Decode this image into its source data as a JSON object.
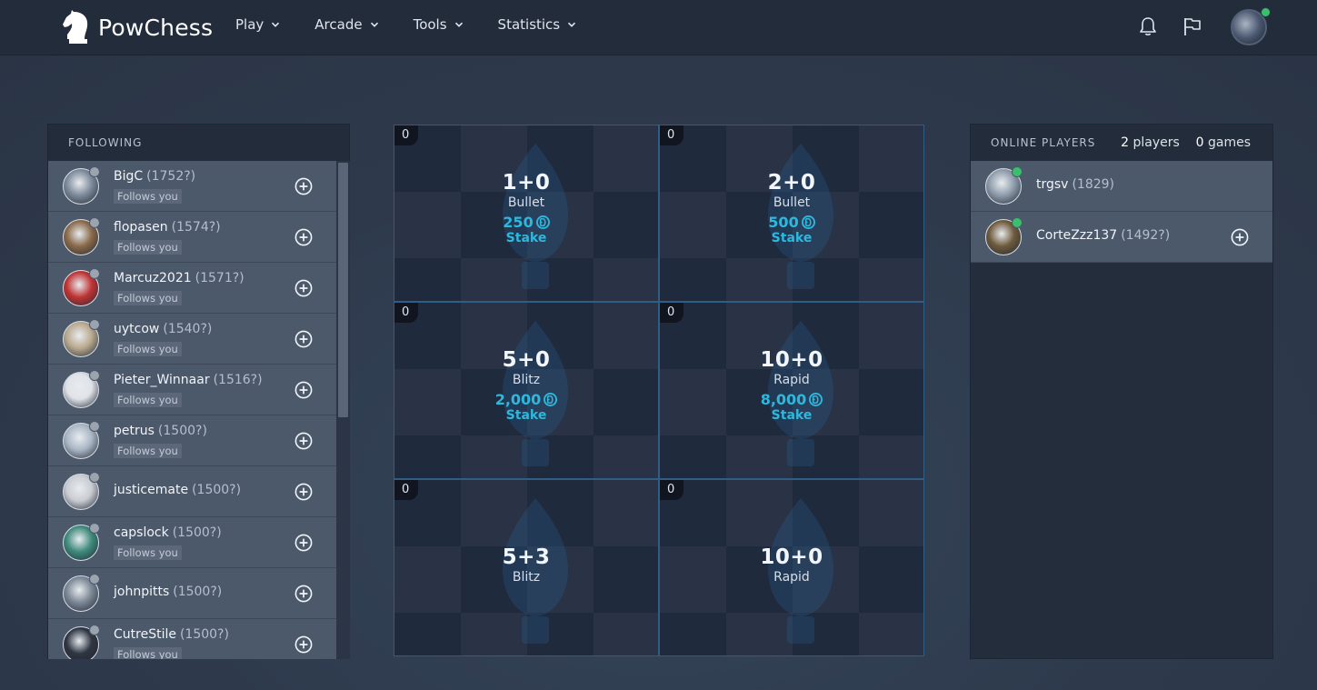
{
  "app": {
    "name": "PowChess"
  },
  "nav": [
    {
      "label": "Play"
    },
    {
      "label": "Arcade"
    },
    {
      "label": "Tools"
    },
    {
      "label": "Statistics"
    }
  ],
  "following": {
    "title": "FOLLOWING",
    "rows": [
      {
        "name": "BigC",
        "rating": "(1752?)",
        "sub": "Follows you",
        "avatar": "#7d8a9a"
      },
      {
        "name": "flopasen",
        "rating": "(1574?)",
        "sub": "Follows you",
        "avatar": "#8a6a4a"
      },
      {
        "name": "Marcuz2021",
        "rating": "(1571?)",
        "sub": "Follows you",
        "avatar": "#c03434"
      },
      {
        "name": "uytcow",
        "rating": "(1540?)",
        "sub": "Follows you",
        "avatar": "#b9a98f"
      },
      {
        "name": "Pieter_Winnaar",
        "rating": "(1516?)",
        "sub": "Follows you",
        "avatar": "#dfe3e8"
      },
      {
        "name": "petrus",
        "rating": "(1500?)",
        "sub": "Follows you",
        "avatar": "#a9b6c4"
      },
      {
        "name": "justicemate",
        "rating": "(1500?)",
        "sub": "",
        "avatar": "#c9ccd2"
      },
      {
        "name": "capslock",
        "rating": "(1500?)",
        "sub": "Follows you",
        "avatar": "#3f8a7b"
      },
      {
        "name": "johnpitts",
        "rating": "(1500?)",
        "sub": "",
        "avatar": "#7c8795"
      },
      {
        "name": "CutreStile",
        "rating": "(1500?)",
        "sub": "Follows you",
        "avatar": "#2f3642"
      }
    ]
  },
  "games": [
    {
      "count": "0",
      "time": "1+0",
      "mode": "Bullet",
      "stake": "250",
      "stake_label": "Stake"
    },
    {
      "count": "0",
      "time": "2+0",
      "mode": "Bullet",
      "stake": "500",
      "stake_label": "Stake"
    },
    {
      "count": "0",
      "time": "5+0",
      "mode": "Blitz",
      "stake": "2,000",
      "stake_label": "Stake"
    },
    {
      "count": "0",
      "time": "10+0",
      "mode": "Rapid",
      "stake": "8,000",
      "stake_label": "Stake"
    },
    {
      "count": "0",
      "time": "5+3",
      "mode": "Blitz",
      "stake": "",
      "stake_label": ""
    },
    {
      "count": "0",
      "time": "10+0",
      "mode": "Rapid",
      "stake": "",
      "stake_label": ""
    }
  ],
  "online": {
    "title": "ONLINE PLAYERS",
    "players_count": "2",
    "players_label": "players",
    "games_count": "0",
    "games_label": "games",
    "rows": [
      {
        "name": "trgsv",
        "rating": "(1829)",
        "avatar": "#8e9cab"
      },
      {
        "name": "CorteZzz137",
        "rating": "(1492?)",
        "avatar": "#6e5a3c"
      }
    ]
  },
  "colors": {
    "accent": "#2db8de",
    "online": "#39c06b",
    "offline": "#9aa3ae"
  }
}
